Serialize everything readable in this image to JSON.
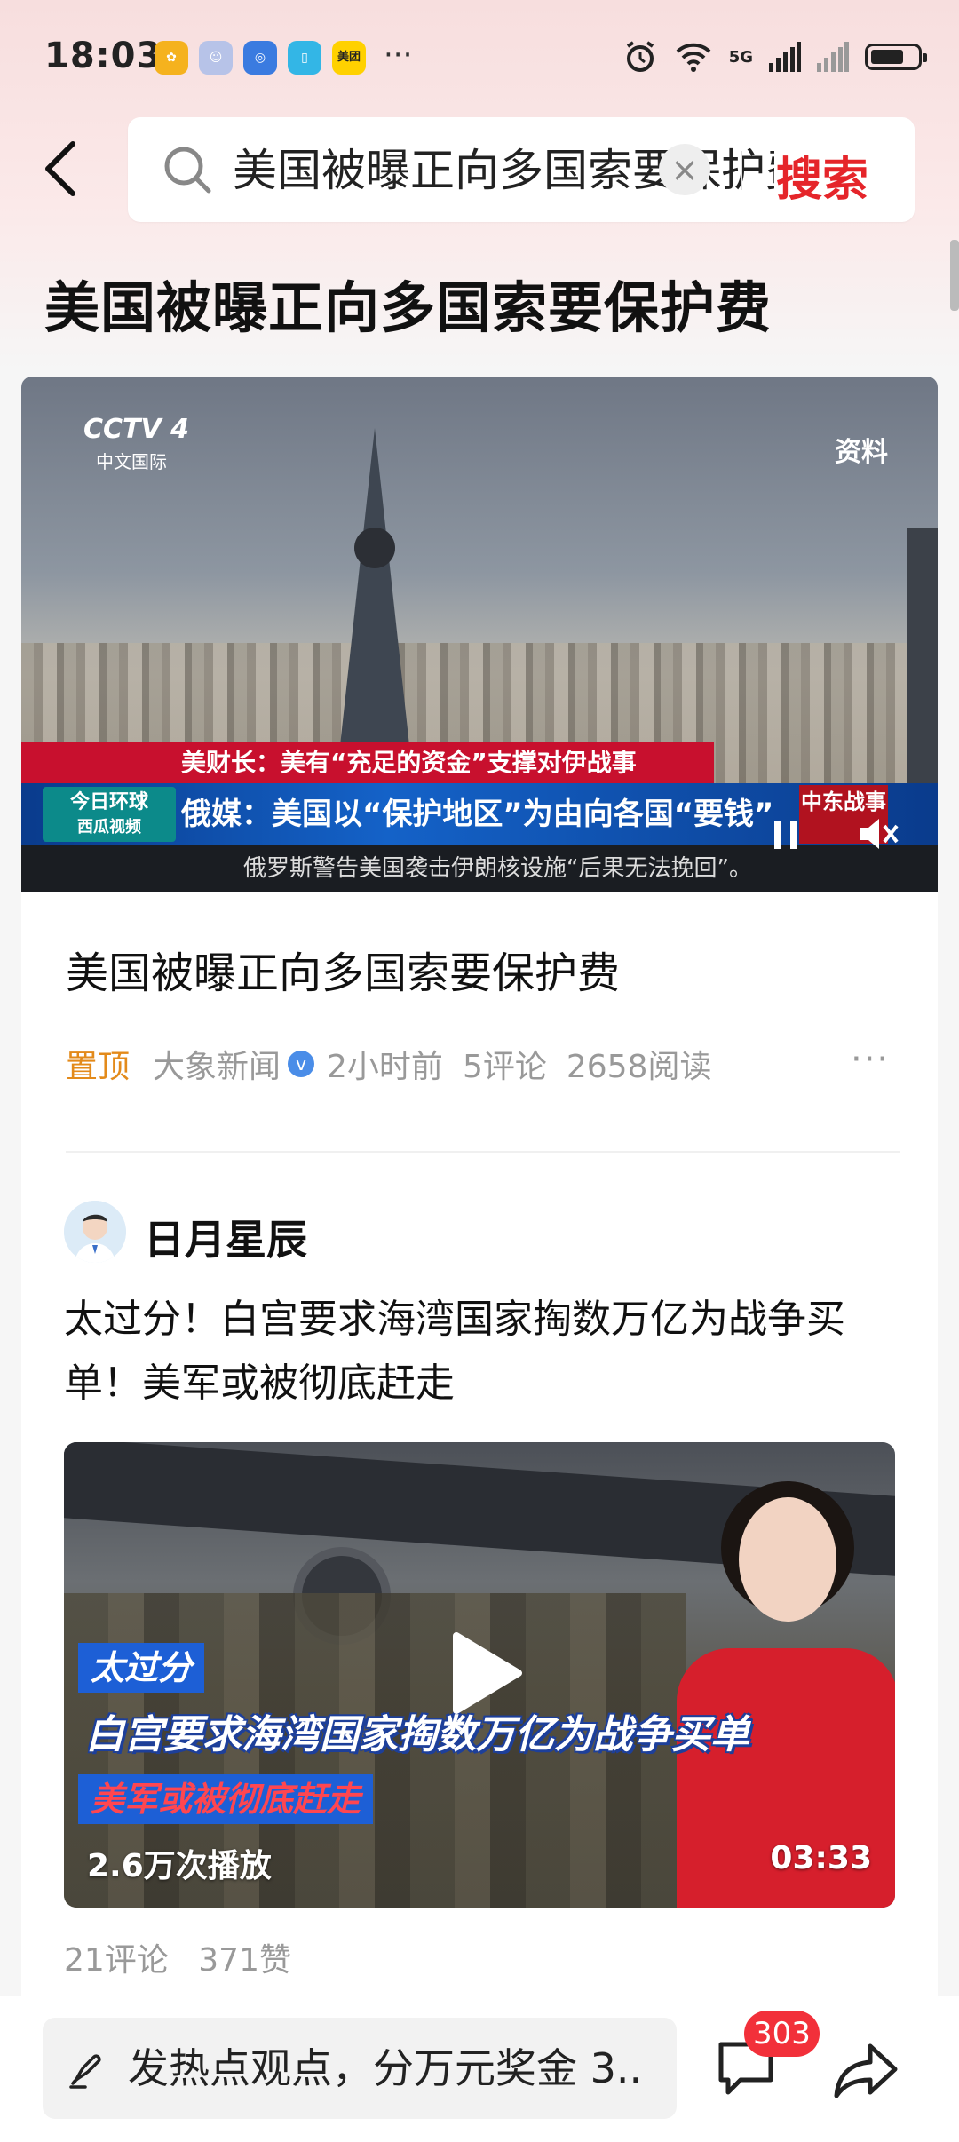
{
  "status_bar": {
    "time": "18:03",
    "apps": [
      {
        "name": "pinwheel-app-icon",
        "color": "#f5b21e"
      },
      {
        "name": "chat-bot-app-icon",
        "color": "#b7c3e8"
      },
      {
        "name": "lightbulb-app-icon",
        "color": "#3a7be0"
      },
      {
        "name": "book-app-icon",
        "color": "#33b6e6"
      },
      {
        "name": "meituan-app-icon",
        "color": "#ffd100",
        "label": "美团"
      }
    ],
    "more": "···",
    "network": "5G"
  },
  "search": {
    "query": "美国被曝正向多国索要保护费",
    "button_label": "搜索"
  },
  "page_title": "美国被曝正向多国索要保护费",
  "featured": {
    "video": {
      "channel_logo": "CCTV 4",
      "channel_sub": "中文国际",
      "watermark": "资料",
      "ticker_red": "美财长：美有“充足的资金”支撑对伊战事",
      "ticker_blue": "俄媒：美国以“保护地区”为由向各国“要钱”",
      "program": "今日环球",
      "section_tag": "中东战事",
      "ticker_bottom": "俄罗斯警告美国袭击伊朗核设施“后果无法挽回”。",
      "watermark_brand": "西瓜视频"
    },
    "title": "美国被曝正向多国索要保护费",
    "pin_label": "置顶",
    "source": "大象新闻",
    "time": "2小时前",
    "comments": "5评论",
    "reads": "2658阅读",
    "more": "···"
  },
  "post": {
    "author": "日月星辰",
    "text": "太过分！白宫要求海湾国家掏数万亿为战争买单！美军或被彻底赶走",
    "video": {
      "overlay_line1": "太过分",
      "overlay_line2": "白宫要求海湾国家掏数万亿为战争买单",
      "overlay_line3": "美军或被彻底赶走",
      "play_count": "2.6万次播放",
      "duration": "03:33"
    },
    "comments": "21评论",
    "likes": "371赞"
  },
  "bottom_bar": {
    "input_placeholder": "发热点观点，分万元奖金 3..",
    "comment_badge": "303"
  },
  "colors": {
    "accent_red": "#e5252a",
    "pin_orange": "#e38a1a",
    "badge_red": "#f2303a",
    "verified_blue": "#4a8de8"
  }
}
